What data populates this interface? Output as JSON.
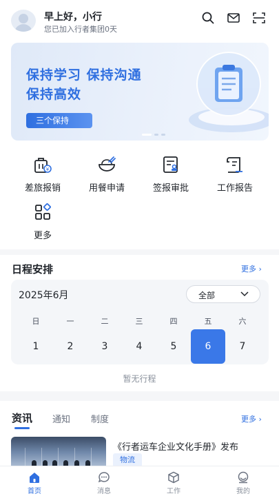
{
  "header": {
    "greeting": "早上好，小行",
    "subtitle": "您已加入行者集团0天",
    "icons": [
      "search-icon",
      "mail-icon",
      "scan-icon"
    ]
  },
  "banner": {
    "line1": "保持学习 保持沟通",
    "line2": "保持高效",
    "button_label": "三个保持",
    "carousel_active_index": 0,
    "carousel_count": 3
  },
  "apps": [
    {
      "label": "差旅报销",
      "icon": "travel-reimburse-icon"
    },
    {
      "label": "用餐申请",
      "icon": "meal-request-icon"
    },
    {
      "label": "签报审批",
      "icon": "approval-icon"
    },
    {
      "label": "工作报告",
      "icon": "work-report-icon"
    },
    {
      "label": "更多",
      "icon": "more-apps-icon"
    }
  ],
  "schedule": {
    "title": "日程安排",
    "more_label": "更多 ›",
    "month_label": "2025年6月",
    "filter_value": "全部",
    "weekdays": [
      "日",
      "一",
      "二",
      "三",
      "四",
      "五",
      "六"
    ],
    "days": [
      "1",
      "2",
      "3",
      "4",
      "5",
      "6",
      "7"
    ],
    "selected_day": "6",
    "empty_text": "暂无行程"
  },
  "news": {
    "tabs": [
      "资讯",
      "通知",
      "制度"
    ],
    "active_tab": "资讯",
    "more_label": "更多 ›",
    "items": [
      {
        "title": "《行者运车企业文化手册》发布",
        "tag": "物流"
      }
    ]
  },
  "tabbar": {
    "items": [
      {
        "label": "首页",
        "icon": "home-icon"
      },
      {
        "label": "消息",
        "icon": "message-icon"
      },
      {
        "label": "工作",
        "icon": "work-icon"
      },
      {
        "label": "我的",
        "icon": "profile-icon"
      }
    ],
    "active": "首页"
  },
  "colors": {
    "accent": "#2f6fe0",
    "selected_day_bg": "#3a78e8",
    "page_bg": "#f5f6f8"
  }
}
